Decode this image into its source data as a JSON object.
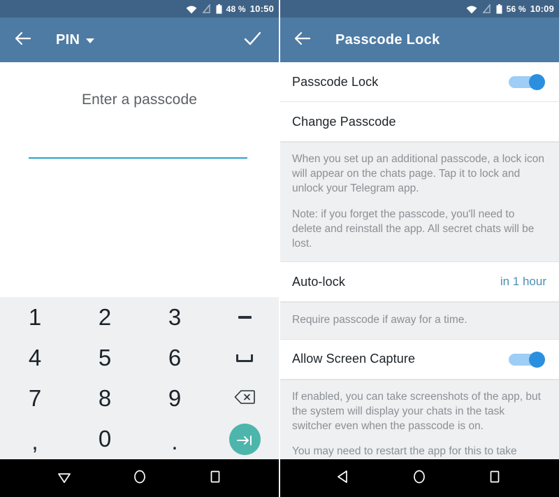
{
  "left": {
    "statusbar": {
      "battery_percent": "48 %",
      "time": "10:50",
      "icons": [
        "wifi-icon",
        "no-sim-icon",
        "battery-icon"
      ]
    },
    "toolbar": {
      "back_icon": "arrow-left-icon",
      "title": "PIN",
      "caret_icon": "chevron-down-icon",
      "confirm_icon": "check-icon"
    },
    "entry": {
      "hint": "Enter a passcode",
      "value": "",
      "underline_color": "#2aa2cf"
    },
    "keypad": {
      "keys": [
        {
          "label": "1",
          "kind": "digit"
        },
        {
          "label": "2",
          "kind": "digit"
        },
        {
          "label": "3",
          "kind": "digit"
        },
        {
          "label": "−",
          "kind": "dash"
        },
        {
          "label": "4",
          "kind": "digit"
        },
        {
          "label": "5",
          "kind": "digit"
        },
        {
          "label": "6",
          "kind": "digit"
        },
        {
          "label": "␣",
          "kind": "space"
        },
        {
          "label": "7",
          "kind": "digit"
        },
        {
          "label": "8",
          "kind": "digit"
        },
        {
          "label": "9",
          "kind": "digit"
        },
        {
          "label": "⌫",
          "kind": "backspace"
        },
        {
          "label": ",",
          "kind": "comma"
        },
        {
          "label": "0",
          "kind": "digit"
        },
        {
          "label": ".",
          "kind": "dot"
        },
        {
          "label": "→|",
          "kind": "enter"
        }
      ],
      "enter_color": "#4db5ac",
      "background": "#eef0f2"
    },
    "navbar": {
      "back_icon": "triangle-down-icon",
      "home_icon": "circle-icon",
      "recents_icon": "square-icon"
    }
  },
  "right": {
    "statusbar": {
      "battery_percent": "56 %",
      "time": "10:09",
      "icons": [
        "wifi-icon",
        "no-sim-icon",
        "battery-icon"
      ]
    },
    "toolbar": {
      "back_icon": "arrow-left-icon",
      "title": "Passcode Lock"
    },
    "rows": {
      "passcode_lock": {
        "label": "Passcode Lock",
        "toggle": "on"
      },
      "change_passcode": {
        "label": "Change Passcode"
      },
      "auto_lock": {
        "label": "Auto-lock",
        "value": "in 1 hour"
      },
      "allow_screen_capture": {
        "label": "Allow Screen Capture",
        "toggle": "on"
      }
    },
    "descriptions": {
      "passcode_p1": "When you set up an additional passcode, a lock icon will appear on the chats page. Tap it to lock and unlock your Telegram app.",
      "passcode_p2": "Note: if you forget the passcode, you'll need to delete and reinstall the app. All secret chats will be lost.",
      "auto_lock": "Require passcode if away for a time.",
      "capture_p1": "If enabled, you can take screenshots of the app, but the system will display your chats in the task switcher even when the passcode is on.",
      "capture_p2": "You may need to restart the app for this to take effect."
    },
    "navbar": {
      "back_icon": "triangle-left-icon",
      "home_icon": "circle-icon",
      "recents_icon": "square-icon"
    }
  },
  "colors": {
    "statusbar": "#3f6386",
    "toolbar": "#4e7ba4",
    "accent_teal": "#4db5ac",
    "toggle_on": "#2b8fe0",
    "link_blue": "#4a90b5"
  }
}
